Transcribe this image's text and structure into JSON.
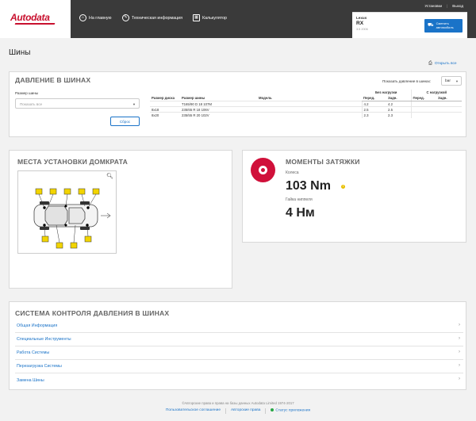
{
  "header": {
    "logo_text": "Autodata",
    "nav": [
      {
        "label": "На главную",
        "icon": "home-icon"
      },
      {
        "label": "Техническая информация",
        "icon": "wrench-icon"
      },
      {
        "label": "Калькулятор",
        "icon": "calculator-icon"
      }
    ],
    "settings_label": "Установки",
    "logout_label": "Выход",
    "vehicle": {
      "make": "Lexus",
      "model": "RX",
      "variant": "3.5 2006",
      "change_label": "Сменить автомобиль"
    }
  },
  "page": {
    "title": "Шины",
    "print_label": "Открыть все"
  },
  "tyre_pressure": {
    "title": "ДАВЛЕНИЕ В ШИНАХ",
    "show_pressure_label": "Показать давление в шинах:",
    "unit": "bar",
    "size_label": "Размер шины",
    "size_placeholder": "Показать все",
    "reset_label": "Сброс",
    "headers": {
      "rim": "Размер диска",
      "tyre": "Размер шины",
      "model": "Модель",
      "unladen": "Без нагрузки",
      "laden": "С нагрузкой",
      "front": "Перед.",
      "rear": "Задн."
    },
    "rows": [
      {
        "rim": "",
        "tyre": "T165/90 D 18 107M",
        "model": "",
        "u_front": "4.2",
        "u_rear": "4.2",
        "l_front": "",
        "l_rear": ""
      },
      {
        "rim": "8x18",
        "tyre": "235/65 R 18 106V",
        "model": "",
        "u_front": "2.5",
        "u_rear": "2.5",
        "l_front": "",
        "l_rear": ""
      },
      {
        "rim": "8x20",
        "tyre": "235/55 R 20 102V",
        "model": "",
        "u_front": "2.3",
        "u_rear": "2.3",
        "l_front": "",
        "l_rear": ""
      }
    ]
  },
  "jacking": {
    "title": "МЕСТА УСТАНОВКИ ДОМКРАТА",
    "zoom_icon": "zoom-icon"
  },
  "torque": {
    "title": "МОМЕНТЫ ЗАТЯЖКИ",
    "wheel_label": "Колеса",
    "wheel_value": "103 Nm",
    "nut_label": "Гайка ниппеля",
    "nut_value": "4 Нм",
    "accent": "#d0103a"
  },
  "tpms": {
    "title": "СИСТЕМА КОНТРОЛЯ ДАВЛЕНИЯ В ШИНАХ",
    "items": [
      "Общая Информация",
      "Специальные Инструменты",
      "Работа Системы",
      "Перезагрузка Системы",
      "Замена Шины"
    ]
  },
  "footer": {
    "copyright": "©Авторские права и права на базы данных Autodata Limited 1974-2017",
    "links": [
      "Пользовательское соглашение",
      "Авторские права",
      "Статус приложения"
    ]
  },
  "colors": {
    "brand": "#c8102e",
    "link": "#1a73c8",
    "header_bg": "#3a3a3a"
  }
}
